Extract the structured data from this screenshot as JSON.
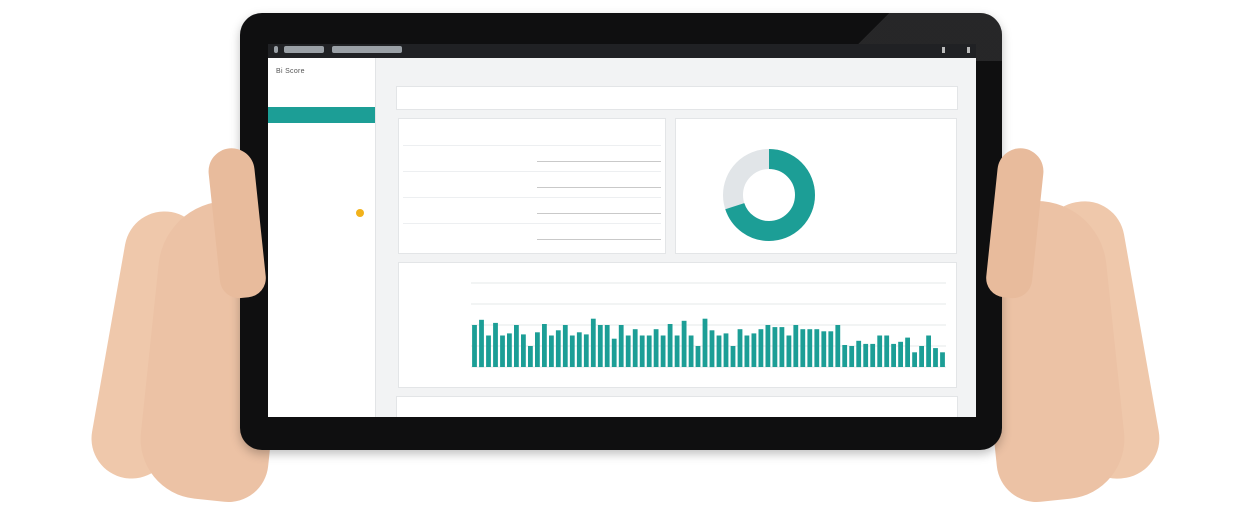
{
  "app": {
    "title": "Bi Score",
    "window_title": "",
    "main_title": ""
  },
  "sidebar": {
    "items": [
      {
        "label": "",
        "active": false
      },
      {
        "label": "",
        "active": true
      },
      {
        "label": "",
        "active": false
      },
      {
        "label": "",
        "active": false
      },
      {
        "label": "",
        "active": false
      },
      {
        "label": "",
        "active": false
      },
      {
        "label": "",
        "active": false
      },
      {
        "label": "",
        "active": false
      }
    ]
  },
  "filter": {
    "text": ""
  },
  "table": {
    "headers": [
      "",
      ""
    ],
    "rows": [
      {
        "metric": "",
        "label": "",
        "val1": "",
        "val2": ""
      },
      {
        "metric": "",
        "label": "",
        "val1": "",
        "val2": ""
      },
      {
        "metric": "",
        "label": "",
        "val1": "",
        "val2": ""
      },
      {
        "metric": "",
        "label": "",
        "val1": "",
        "val2": ""
      }
    ]
  },
  "donut": {
    "title": "",
    "legend_title": "",
    "accent": "#1c9e96",
    "rest": "#e1e5e8",
    "legend": [
      {
        "a": "",
        "b": ""
      },
      {
        "a": "",
        "b": ""
      },
      {
        "a": "",
        "b": ""
      },
      {
        "a": "",
        "b": ""
      }
    ]
  },
  "bottom": {
    "title": ""
  },
  "colors": {
    "accent": "#1c9e96",
    "notification": "#f2b21b",
    "bezel": "#0f0f10"
  },
  "chart_data": {
    "type": "bar",
    "title": "",
    "xlabel": "",
    "ylabel": "",
    "ylim": [
      0,
      8
    ],
    "grid": true,
    "categories": [],
    "values": [
      4.0,
      4.5,
      3.0,
      4.2,
      3.0,
      3.2,
      4.0,
      3.1,
      2.0,
      3.3,
      4.1,
      3.0,
      3.5,
      4.0,
      3.0,
      3.3,
      3.1,
      4.6,
      4.0,
      4.0,
      2.7,
      4.0,
      3.0,
      3.6,
      3.0,
      3.0,
      3.6,
      3.0,
      4.1,
      3.0,
      4.4,
      3.0,
      2.0,
      4.6,
      3.5,
      3.0,
      3.2,
      2.0,
      3.6,
      3.0,
      3.2,
      3.6,
      4.0,
      3.8,
      3.8,
      3.0,
      4.0,
      3.6,
      3.6,
      3.6,
      3.4,
      3.4,
      4.0,
      2.1,
      2.0,
      2.5,
      2.2,
      2.2,
      3.0,
      3.0,
      2.2,
      2.4,
      2.8,
      1.4,
      2.0,
      3.0,
      1.8,
      1.4
    ]
  }
}
